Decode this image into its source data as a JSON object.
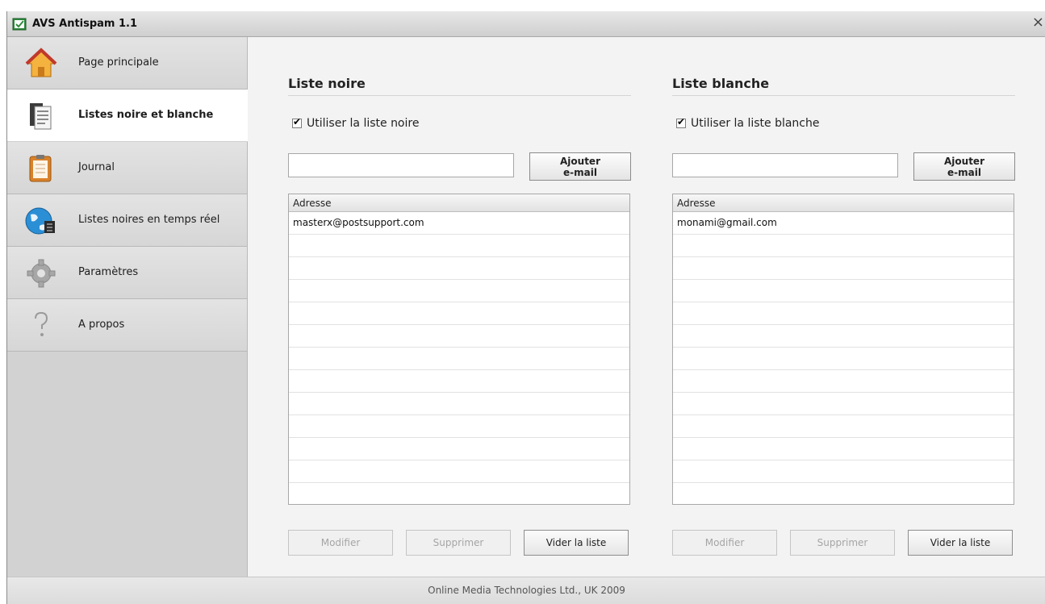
{
  "window": {
    "title": "AVS Antispam 1.1",
    "close_glyph": "×"
  },
  "sidebar": {
    "items": [
      {
        "label": "Page principale",
        "icon": "home-icon",
        "active": false
      },
      {
        "label": "Listes noire et blanche",
        "icon": "list-document-icon",
        "active": true
      },
      {
        "label": "Journal",
        "icon": "clipboard-icon",
        "active": false
      },
      {
        "label": "Listes noires en temps réel",
        "icon": "globe-icon",
        "active": false
      },
      {
        "label": "Paramètres",
        "icon": "gear-icon",
        "active": false
      },
      {
        "label": "A propos",
        "icon": "question-icon",
        "active": false
      }
    ]
  },
  "blacklist": {
    "title": "Liste noire",
    "checkbox_label": "Utiliser la liste noire",
    "checkbox_checked": true,
    "input_value": "",
    "add_button_line1": "Ajouter",
    "add_button_line2": "e-mail",
    "column_header": "Adresse",
    "rows": [
      "masterx@postsupport.com",
      "",
      "",
      "",
      "",
      "",
      "",
      "",
      "",
      "",
      "",
      ""
    ],
    "modify_label": "Modifier",
    "delete_label": "Supprimer",
    "clear_label": "Vider la liste"
  },
  "whitelist": {
    "title": "Liste blanche",
    "checkbox_label": "Utiliser la liste blanche",
    "checkbox_checked": true,
    "input_value": "",
    "add_button_line1": "Ajouter",
    "add_button_line2": "e-mail",
    "column_header": "Adresse",
    "rows": [
      "monami@gmail.com",
      "",
      "",
      "",
      "",
      "",
      "",
      "",
      "",
      "",
      "",
      ""
    ],
    "modify_label": "Modifier",
    "delete_label": "Supprimer",
    "clear_label": "Vider la liste"
  },
  "status": {
    "text": "Online Media Technologies Ltd., UK 2009"
  },
  "colors": {
    "sidebar_bg": "#d2d2d2",
    "active_item_bg": "#ffffff",
    "content_bg": "#f3f3f3",
    "disabled_text": "#a5a5a5"
  }
}
